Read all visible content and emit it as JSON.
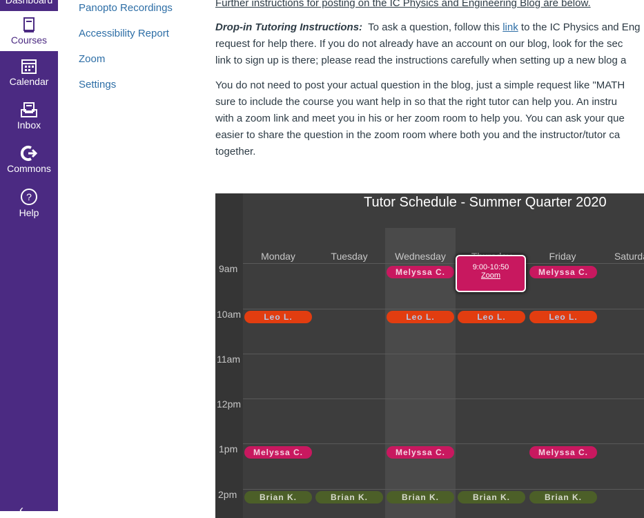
{
  "global_nav": {
    "dashboard": "Dashboard",
    "courses": "Courses",
    "calendar": "Calendar",
    "inbox": "Inbox",
    "commons": "Commons",
    "help": "Help"
  },
  "course_nav": [
    "Panopto Recordings",
    "Accessibility Report",
    "Zoom",
    "Settings"
  ],
  "content": {
    "line0": "Further instructions for posting on the IC Physics and Engineering Blog are below.",
    "p1_label": "Drop-in Tutoring Instructions:",
    "p1_a": "  To ask a question, follow this ",
    "p1_link": "link",
    "p1_b": " to the IC Physics and Eng",
    "p1_l2": "request for help there.  If you do not already have an account on our blog, look for the sec",
    "p1_l3": "link to sign up is there; please read the instructions carefully when setting up a new blog a",
    "p2_l1": "You do not need to post your actual question in the blog, just a simple request like \"MATH",
    "p2_l2": "sure to include the course you want help in so that the right tutor can help you.  An instru",
    "p2_l3": "with a zoom link and meet you in his or her zoom room to help you.  You can ask your que",
    "p2_l4": "easier to share the question in the zoom room where both you and the instructor/tutor ca",
    "p2_l5": "together."
  },
  "schedule": {
    "title": "Tutor Schedule - Summer Quarter 2020",
    "days": [
      "Monday",
      "Tuesday",
      "Wednesday",
      "Thursday",
      "Friday",
      "Saturday"
    ],
    "hours": [
      "9am",
      "10am",
      "11am",
      "12pm",
      "1pm",
      "2pm"
    ],
    "events": {
      "mon_10": "Leo L.",
      "mon_1": "Melyssa C.",
      "mon_2": "Brian K.",
      "tue_2": "Brian K.",
      "wed_9": "Melyssa C.",
      "wed_10": "Leo L.",
      "wed_1": "Melyssa C.",
      "wed_2": "Brian K.",
      "thu_10": "Leo L.",
      "thu_2": "Brian K.",
      "fri_9": "Melyssa C.",
      "fri_10": "Leo L.",
      "fri_1": "Melyssa C.",
      "fri_2": "Brian K."
    },
    "popup": {
      "time": "9:00-10:50",
      "link": "Zoom"
    },
    "colors": {
      "melyssa": "#c8185f",
      "leo": "#e23d10",
      "brian": "#4c5f28"
    }
  }
}
